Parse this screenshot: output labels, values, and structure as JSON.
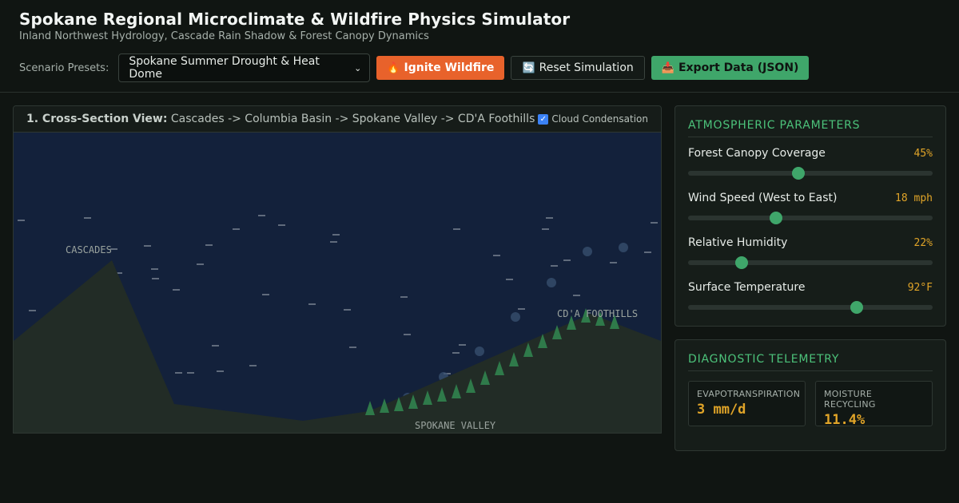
{
  "header": {
    "title": "Spokane Regional Microclimate & Wildfire Physics Simulator",
    "subtitle": "Inland Northwest Hydrology, Cascade Rain Shadow & Forest Canopy Dynamics"
  },
  "toolbar": {
    "preset_label": "Scenario Presets:",
    "preset_selected": "Spokane Summer Drought & Heat Dome",
    "ignite_label": "Ignite Wildfire",
    "reset_label": "Reset Simulation",
    "export_label": "Export Data (JSON)",
    "ignite_icon": "fire-icon",
    "reset_icon": "refresh-icon",
    "export_icon": "inbox-tray-icon"
  },
  "cross_section": {
    "title_prefix": "1. Cross-Section View:",
    "title_route": " Cascades -> Columbia Basin -> Spokane Valley -> CD'A Foothills",
    "cloud_condensation_label": "Cloud Condensation",
    "cloud_condensation_checked": true,
    "labels": {
      "cascades": "CASCADES",
      "spokane_valley": "SPOKANE VALLEY",
      "cda_foothills": "CD'A FOOTHILLS"
    }
  },
  "atmospheric": {
    "title": "ATMOSPHERIC PARAMETERS",
    "params": [
      {
        "label": "Forest Canopy Coverage",
        "value": "45%",
        "fraction": 0.45
      },
      {
        "label": "Wind Speed (West to East)",
        "value": "18 mph",
        "fraction": 0.36
      },
      {
        "label": "Relative Humidity",
        "value": "22%",
        "fraction": 0.22
      },
      {
        "label": "Surface Temperature",
        "value": "92°F",
        "fraction": 0.69
      }
    ]
  },
  "telemetry": {
    "title": "DIAGNOSTIC TELEMETRY",
    "cards": [
      {
        "label": "EVAPOTRANSPIRATION",
        "value": "3 mm/d"
      },
      {
        "label": "MOISTURE RECYCLING",
        "value": "11.4%"
      }
    ]
  },
  "colors": {
    "accent_green": "#3fa66a",
    "ignite_orange": "#e8622b",
    "value_amber": "#e0a428",
    "sky_navy": "#13213b",
    "terrain": "#222c26",
    "tree_green": "#2f7a4a"
  }
}
